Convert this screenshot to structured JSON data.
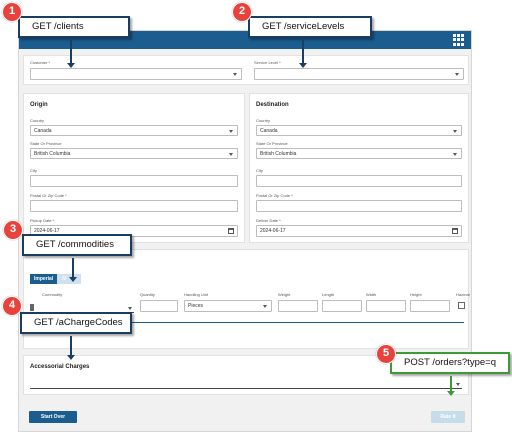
{
  "app": {
    "customer": {
      "label": "Customer *",
      "value": ""
    },
    "service_level": {
      "label": "Service Level *",
      "value": ""
    },
    "origin": {
      "title": "Origin",
      "country_label": "Country",
      "country_value": "Canada",
      "state_label": "State Or Province",
      "state_value": "British Columbia",
      "city_label": "City",
      "postal_label": "Postal Or Zip Code *",
      "date_label": "Pickup Date *",
      "date_value": "2024-06-17"
    },
    "destination": {
      "title": "Destination",
      "country_label": "Country",
      "country_value": "Canada",
      "state_label": "State Or Province",
      "state_value": "British Columbia",
      "city_label": "City",
      "postal_label": "Postal Or Zip Code *",
      "date_label": "Deliver Date *",
      "date_value": "2024-06-17"
    },
    "items": {
      "unit_toggle": [
        "Imperial",
        "M"
      ],
      "columns": {
        "commodity": "Commodity",
        "quantity": "Quantity",
        "handling_unit": "Handling Unit",
        "weight": "Weight",
        "length": "Length",
        "width": "Width",
        "height": "Height",
        "hazmat": "Hazmat"
      },
      "handling_unit_value": "Pieces"
    },
    "accessorial": {
      "title": "Accessorial Charges"
    },
    "buttons": {
      "start_over": "Start Over",
      "rate_it": "Rate It"
    }
  },
  "callouts": [
    {
      "number": "1",
      "text": "GET /clients"
    },
    {
      "number": "2",
      "text": "GET /serviceLevels"
    },
    {
      "number": "3",
      "text": "GET /commodities"
    },
    {
      "number": "4",
      "text": "GET /aChargeCodes"
    },
    {
      "number": "5",
      "text": "POST /orders?type=q"
    }
  ],
  "colors": {
    "header": "#1b5d8f",
    "callout_border": "#1b3d62",
    "callout_green": "#3e9a36",
    "badge": "#e8423d"
  },
  "icons": [
    "apps-grid-icon",
    "chevron-down-icon",
    "calendar-icon",
    "trash-icon",
    "checkbox-icon"
  ]
}
